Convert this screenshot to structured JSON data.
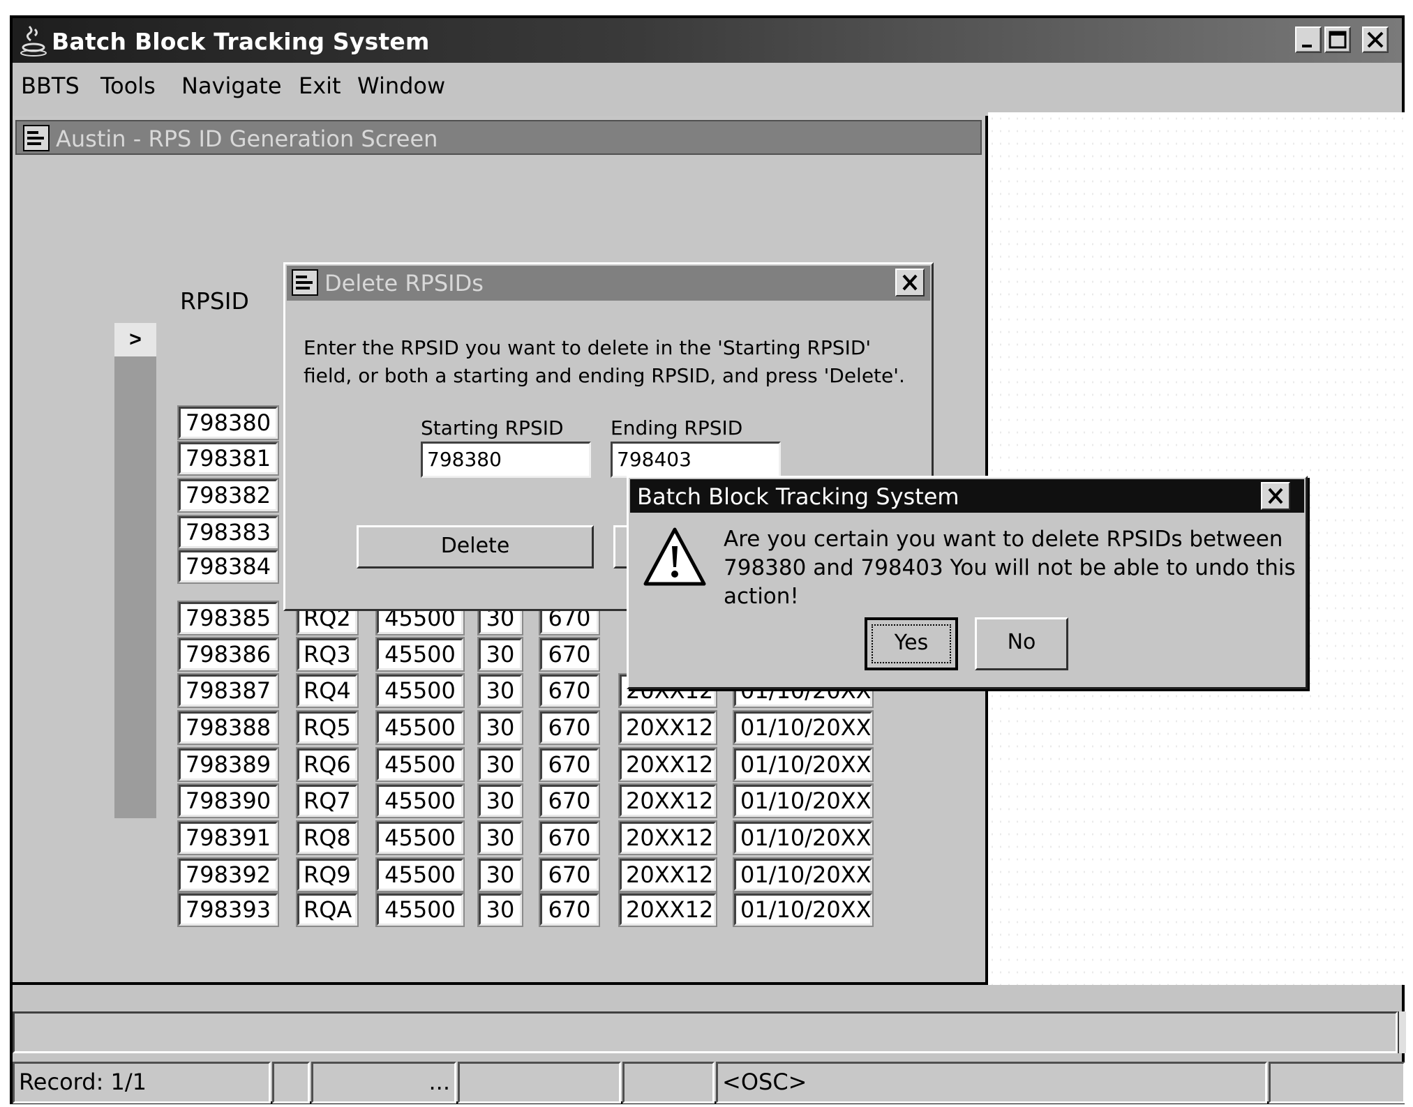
{
  "app": {
    "title": "Batch Block Tracking System",
    "menu": [
      "BBTS",
      "Tools",
      "Navigate",
      "Exit",
      "Window"
    ]
  },
  "inner_window": {
    "title": "Austin - RPS ID Generation Screen",
    "column_header": "RPSID",
    "current_row_marker": ">",
    "rpsids": [
      "798380",
      "798381",
      "798382",
      "798383",
      "798384",
      "798385",
      "798386",
      "798387",
      "798388",
      "798389",
      "798390",
      "798391",
      "798392",
      "798393"
    ],
    "detail_rows": [
      {
        "code": "RQ2",
        "amount": "45500",
        "qty": "30",
        "num": "670"
      },
      {
        "code": "RQ3",
        "amount": "45500",
        "qty": "30",
        "num": "670"
      },
      {
        "code": "RQ4",
        "amount": "45500",
        "qty": "30",
        "num": "670",
        "period": "20XX12",
        "date": "01/10/20XX"
      },
      {
        "code": "RQ5",
        "amount": "45500",
        "qty": "30",
        "num": "670",
        "period": "20XX12",
        "date": "01/10/20XX"
      },
      {
        "code": "RQ6",
        "amount": "45500",
        "qty": "30",
        "num": "670",
        "period": "20XX12",
        "date": "01/10/20XX"
      },
      {
        "code": "RQ7",
        "amount": "45500",
        "qty": "30",
        "num": "670",
        "period": "20XX12",
        "date": "01/10/20XX"
      },
      {
        "code": "RQ8",
        "amount": "45500",
        "qty": "30",
        "num": "670",
        "period": "20XX12",
        "date": "01/10/20XX"
      },
      {
        "code": "RQ9",
        "amount": "45500",
        "qty": "30",
        "num": "670",
        "period": "20XX12",
        "date": "01/10/20XX"
      },
      {
        "code": "RQA",
        "amount": "45500",
        "qty": "30",
        "num": "670",
        "period": "20XX12",
        "date": "01/10/20XX"
      }
    ]
  },
  "delete_dialog": {
    "title": "Delete RPSIDs",
    "instructions": "Enter the RPSID you want to delete in the 'Starting  RPSID' field, or both a starting and ending RPSID, and press 'Delete'.",
    "starting_label": "Starting RPSID",
    "starting_value": "798380",
    "ending_label": "Ending RPSID",
    "ending_value": "798403",
    "delete_label": "Delete"
  },
  "confirm_dialog": {
    "title": "Batch Block Tracking System",
    "message": "Are you certain you want to delete RPSIDs between 798380 and 798403 You will not be able to undo this action!",
    "yes_label": "Yes",
    "no_label": "No"
  },
  "status": {
    "record": "Record: 1/1",
    "ellipsis": "...",
    "mode": "<OSC>"
  }
}
